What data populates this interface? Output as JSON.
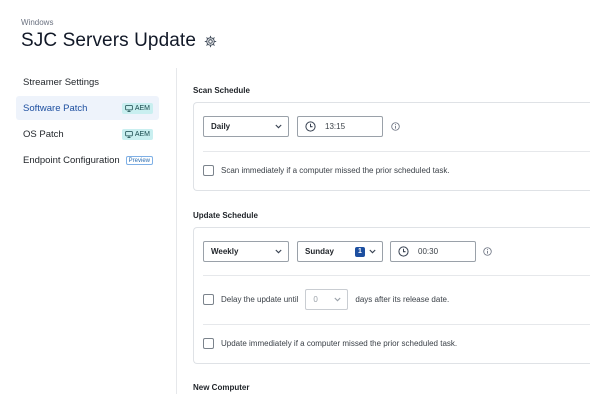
{
  "header": {
    "eyebrow": "Windows",
    "title": "SJC Servers Update",
    "settings_icon": "gear-icon"
  },
  "sidebar": {
    "items": [
      {
        "label": "Streamer Settings",
        "badge": null,
        "active": false
      },
      {
        "label": "Software Patch",
        "badge": "AEM",
        "active": true
      },
      {
        "label": "OS Patch",
        "badge": "AEM",
        "active": false
      },
      {
        "label": "Endpoint Configuration",
        "badge": "Preview",
        "active": false
      }
    ]
  },
  "scan_schedule": {
    "title": "Scan Schedule",
    "frequency": "Daily",
    "time": "13:15",
    "missed_label": "Scan immediately if a computer missed the prior scheduled task."
  },
  "update_schedule": {
    "title": "Update Schedule",
    "frequency": "Weekly",
    "day": "Sunday",
    "day_count": "1",
    "time": "00:30",
    "delay_label_before": "Delay the update until",
    "delay_value": "0",
    "delay_label_after": "days after its release date.",
    "missed_label": "Update immediately if a computer missed the prior scheduled task."
  },
  "new_computer": {
    "title": "New Computer"
  },
  "colors": {
    "accent": "#1d4fa0",
    "active_bg": "#eef3fb",
    "aem_badge_bg": "#c9eff0"
  }
}
